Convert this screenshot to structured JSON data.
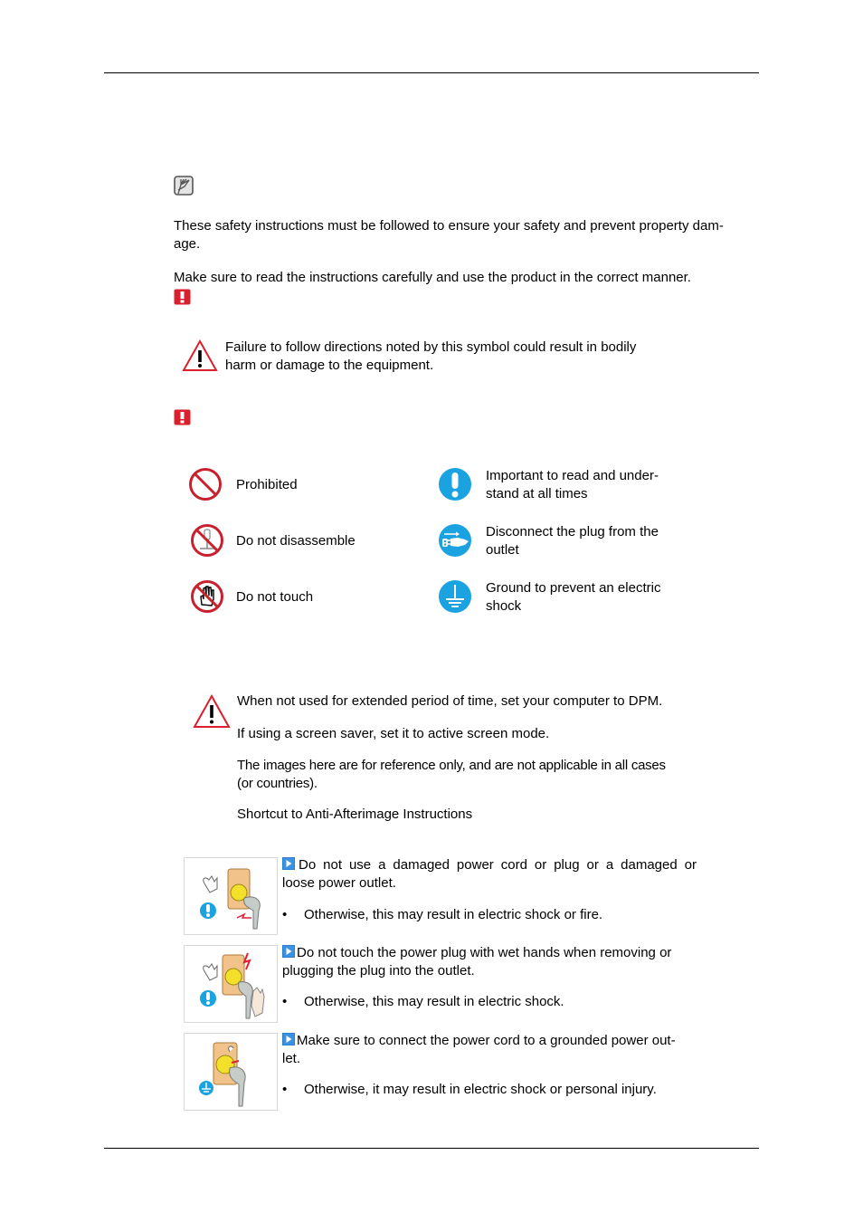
{
  "intro": {
    "paragraph1": "These safety instructions must be followed to ensure your safety and prevent property dam-",
    "paragraph1_cont": "age.",
    "paragraph2": "Make sure to read the instructions carefully and use the product in the correct manner."
  },
  "caution_block": {
    "line1": "Failure to follow directions noted by this symbol could result in bodily",
    "line2": "harm or damage to the equipment."
  },
  "symbols": {
    "left": [
      {
        "icon": "prohibited-icon",
        "label": "Prohibited"
      },
      {
        "icon": "do-not-disassemble-icon",
        "label": "Do not disassemble"
      },
      {
        "icon": "do-not-touch-icon",
        "label": "Do not touch"
      }
    ],
    "right": [
      {
        "icon": "important-icon",
        "label_line1": "Important to read and under-",
        "label_line2": "stand at all times"
      },
      {
        "icon": "disconnect-plug-icon",
        "label_line1": "Disconnect the plug from the",
        "label_line2": "outlet"
      },
      {
        "icon": "ground-icon",
        "label_line1": "Ground to prevent an electric",
        "label_line2": "shock"
      }
    ]
  },
  "notice_block": {
    "line1": "When not used for extended period of time, set your computer to DPM.",
    "line2": "If using a screen saver, set it to active screen mode.",
    "line3a": "The images here are for reference only, and are not applicable in all cases",
    "line3b": "(or countries).",
    "link": "Shortcut to Anti-Afterimage Instructions"
  },
  "items": [
    {
      "heading_line1": "Do not use a damaged power cord or plug or a damaged or",
      "heading_line2": "loose power outlet.",
      "bullet": "Otherwise, this may result in electric shock or fire.",
      "badge": "important-icon"
    },
    {
      "heading_line1": "Do not touch the power plug with wet hands when removing or",
      "heading_line2": "plugging the plug into the outlet.",
      "bullet": "Otherwise, this may result in electric shock.",
      "badge": "important-icon"
    },
    {
      "heading_line1": "Make sure to connect the power cord to a grounded power out-",
      "heading_line2": "let.",
      "bullet": "Otherwise, it may result in electric shock or personal injury.",
      "badge": "ground-icon"
    }
  ],
  "bullet_char": "•",
  "colors": {
    "warning_red": "#d9202c",
    "info_blue": "#1aa3e0",
    "note_gray": "#555555"
  }
}
